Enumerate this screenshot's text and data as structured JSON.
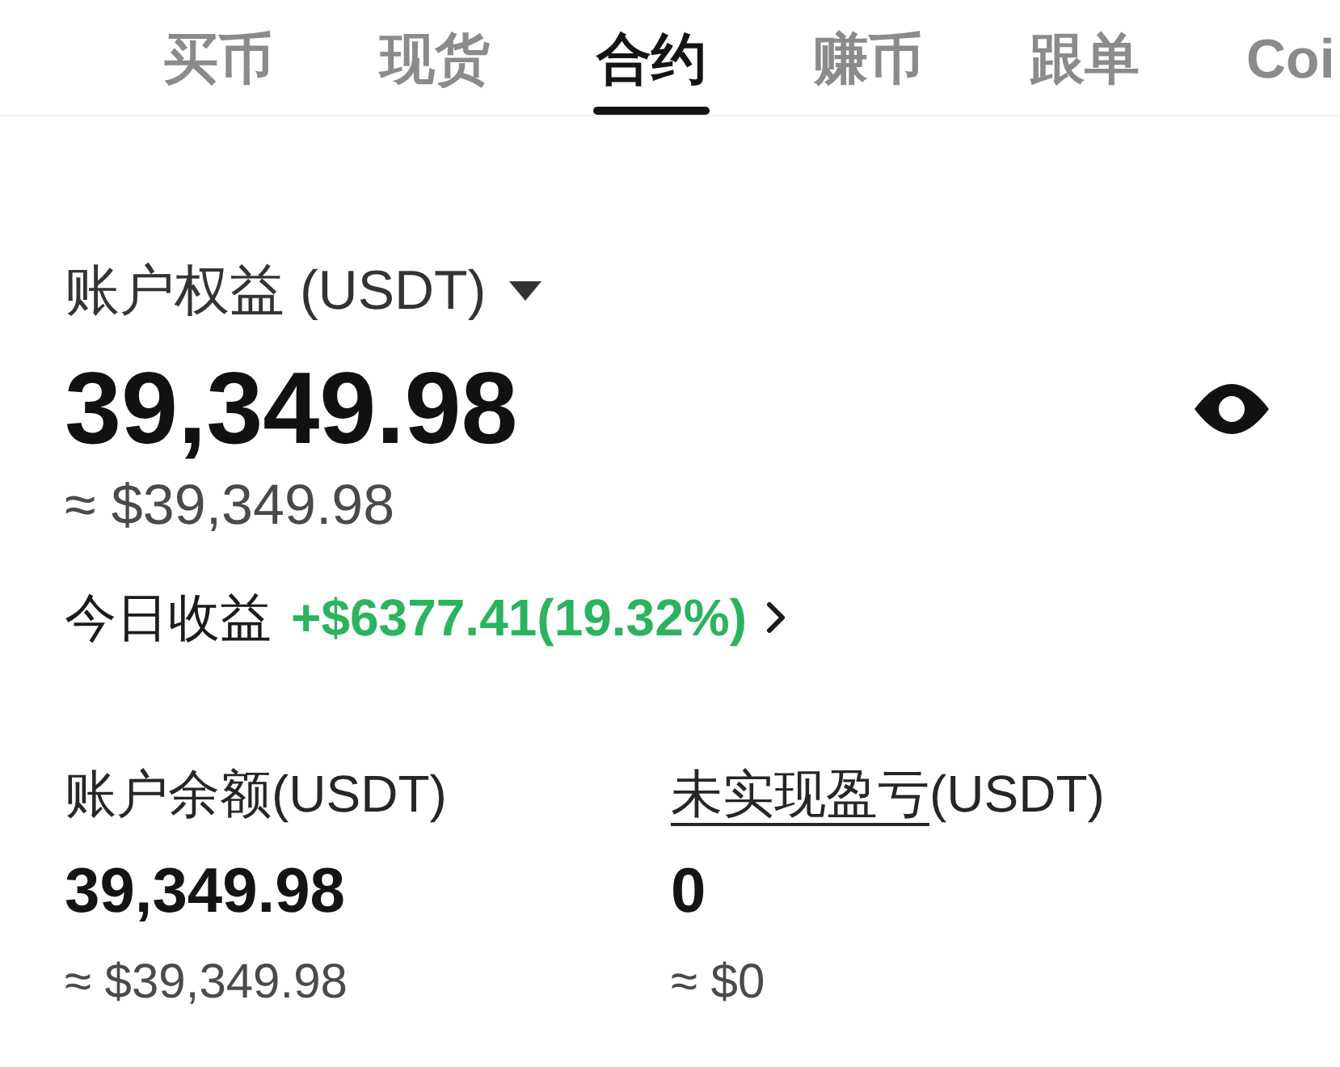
{
  "tabs": [
    {
      "label": "买币",
      "selected": false
    },
    {
      "label": "现货",
      "selected": false
    },
    {
      "label": "合约",
      "selected": true
    },
    {
      "label": "赚币",
      "selected": false
    },
    {
      "label": "跟单",
      "selected": false
    },
    {
      "label": "Coi",
      "selected": false
    }
  ],
  "equity": {
    "label": "账户权益 (USDT)",
    "value": "39,349.98",
    "approx": "≈ $39,349.98"
  },
  "today_pnl": {
    "label": "今日收益",
    "value": "+$6377.41(19.32%)"
  },
  "balances": [
    {
      "label": "账户余额",
      "unit": "(USDT)",
      "underlined": false,
      "value": "39,349.98",
      "approx": "≈ $39,349.98"
    },
    {
      "label": "未实现盈亏",
      "unit": "(USDT)",
      "underlined": true,
      "value": "0",
      "approx": "≈ $0"
    }
  ]
}
